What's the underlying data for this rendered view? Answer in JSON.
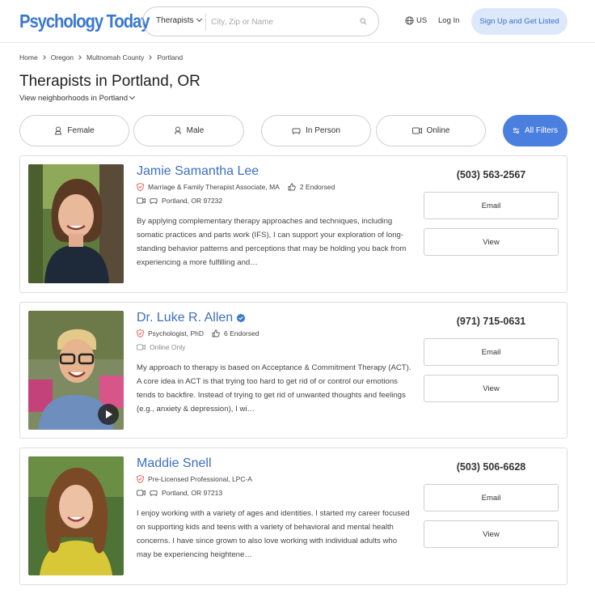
{
  "header": {
    "logo": "Psychology Today",
    "search_type": "Therapists",
    "search_placeholder": "City, Zip or Name",
    "country": "US",
    "login": "Log In",
    "signup": "Sign Up and Get Listed"
  },
  "breadcrumb": [
    "Home",
    "Oregon",
    "Multnomah County",
    "Portland"
  ],
  "title": "Therapists in Portland, OR",
  "neighborhoods_link": "View neighborhoods in Portland",
  "filters": [
    "Female",
    "Male",
    "In Person",
    "Online",
    "All Filters"
  ],
  "therapists": [
    {
      "name": "Jamie Samantha Lee",
      "credentials": "Marriage & Family Therapist Associate, MA",
      "endorsed": "2 Endorsed",
      "location": "Portland, OR 97232",
      "description": "By applying complementary therapy approaches and techniques, including somatic practices and parts work (IFS), I can support your exploration of long-standing behavior patterns and perceptions that may be holding you back from experiencing a more fulfilling and…",
      "phone": "(503) 563-2567",
      "email_label": "Email",
      "view_label": "View"
    },
    {
      "name": "Dr. Luke R. Allen",
      "credentials": "Psychologist, PhD",
      "endorsed": "6 Endorsed",
      "location": "Online Only",
      "description": "My approach to therapy is based on Acceptance & Commitment Therapy (ACT). A core idea in ACT is that trying too hard to get rid of or control our emotions tends to backfire. Instead of trying to get rid of unwanted thoughts and feelings (e.g., anxiety & depression), I wi…",
      "phone": "(971) 715-0631",
      "email_label": "Email",
      "view_label": "View"
    },
    {
      "name": "Maddie Snell",
      "credentials": "Pre-Licensed Professional, LPC-A",
      "location": "Portland, OR 97213",
      "description": "I enjoy working with a variety of ages and identities. I started my career focused on supporting kids and teens with a variety of behavioral and mental health concerns. I have since grown to also love working with individual adults who may be experiencing heightene…",
      "phone": "(503) 506-6628",
      "email_label": "Email",
      "view_label": "View"
    }
  ],
  "colors": {
    "brand_blue": "#3a78d0",
    "name_blue": "#3e6fbe",
    "filter_active": "#4a7fe0",
    "signup_bg": "#dde8fa",
    "check_red": "#d9534f"
  }
}
